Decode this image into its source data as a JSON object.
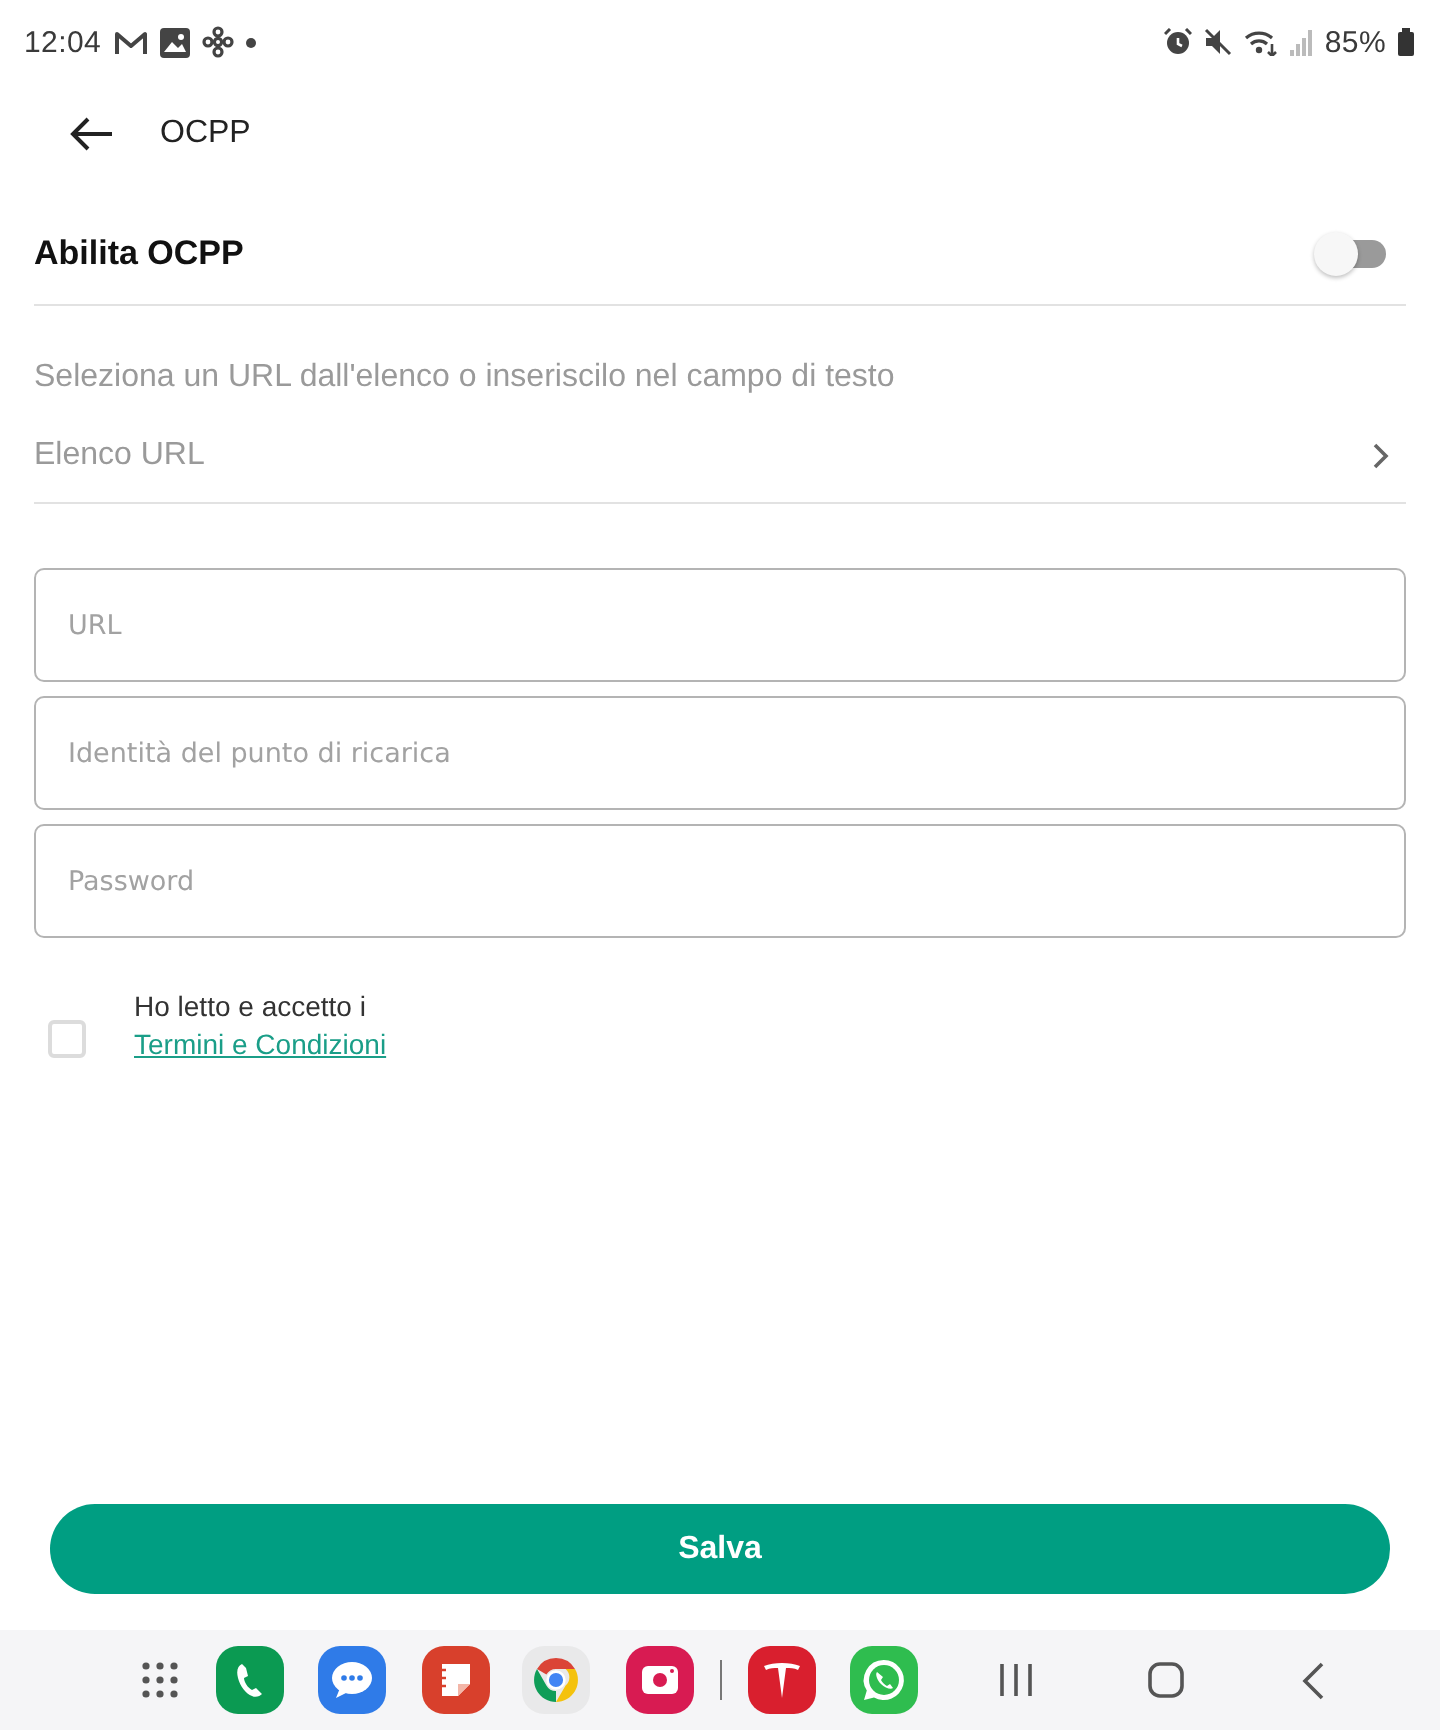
{
  "status_bar": {
    "time": "12:04",
    "battery": "85%"
  },
  "header": {
    "title": "OCPP"
  },
  "enable": {
    "label": "Abilita OCPP",
    "on": false
  },
  "hint": "Seleziona un URL dall'elenco o inseriscilo nel campo di testo",
  "url_list": {
    "label": "Elenco URL"
  },
  "fields": [
    {
      "placeholder": "URL"
    },
    {
      "placeholder": "Identità del punto di ricarica"
    },
    {
      "placeholder": "Password"
    }
  ],
  "terms": {
    "text": "Ho letto e accetto i",
    "link": "Termini e Condizioni",
    "checked": false
  },
  "save_button": "Salva"
}
